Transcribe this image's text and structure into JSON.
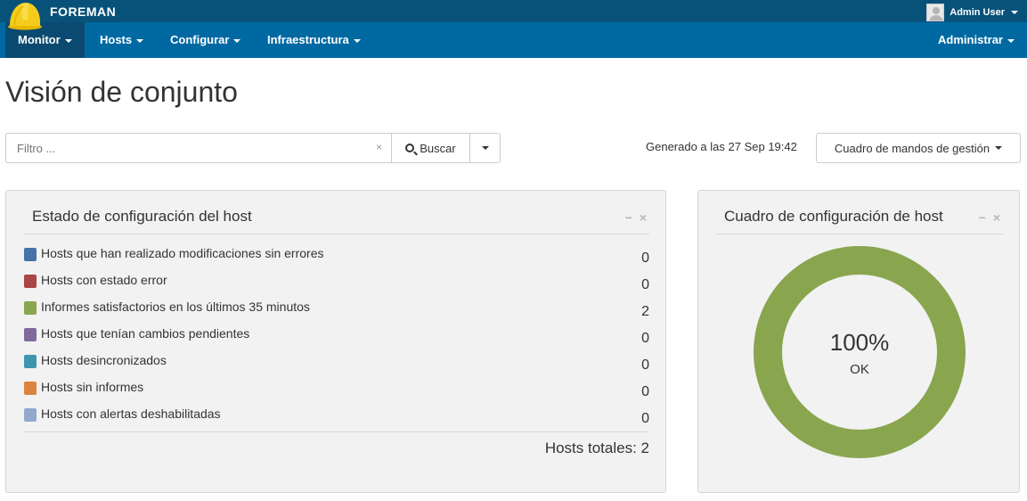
{
  "app": {
    "brand": "FOREMAN"
  },
  "user": {
    "name": "Admin User"
  },
  "nav": {
    "items": [
      {
        "label": "Monitor"
      },
      {
        "label": "Hosts"
      },
      {
        "label": "Configurar"
      },
      {
        "label": "Infraestructura"
      }
    ],
    "admin_label": "Administrar"
  },
  "page": {
    "title": "Visión de conjunto"
  },
  "search": {
    "placeholder": "Filtro ...",
    "button_label": "Buscar",
    "clear": "×"
  },
  "generated": "Generado a las 27 Sep 19:42",
  "dashboard_button": "Cuadro de mandos de gestión",
  "status_panel": {
    "title": "Estado de configuración del host",
    "tools": {
      "minimize": "−",
      "close": "×"
    },
    "rows": [
      {
        "label": "Hosts que han realizado modificaciones sin errores",
        "count": "0",
        "color": "#4572a7"
      },
      {
        "label": "Hosts con estado error",
        "count": "0",
        "color": "#aa4643"
      },
      {
        "label": "Informes satisfactorios en los últimos 35 minutos",
        "count": "2",
        "color": "#89a54e"
      },
      {
        "label": "Hosts que tenían cambios pendientes",
        "count": "0",
        "color": "#80699b"
      },
      {
        "label": "Hosts desincronizados",
        "count": "0",
        "color": "#3d96ae"
      },
      {
        "label": "Hosts sin informes",
        "count": "0",
        "color": "#db843d"
      },
      {
        "label": "Hosts con alertas deshabilitadas",
        "count": "0",
        "color": "#92a8cd"
      }
    ],
    "total": "Hosts totales: 2"
  },
  "chart_panel": {
    "title": "Cuadro de configuración de host",
    "tools": {
      "minimize": "−",
      "close": "×"
    },
    "percent": "100%",
    "status": "OK"
  },
  "chart_data": {
    "type": "pie",
    "categories": [
      "OK"
    ],
    "values": [
      100
    ],
    "colors": [
      "#89a54e"
    ]
  }
}
